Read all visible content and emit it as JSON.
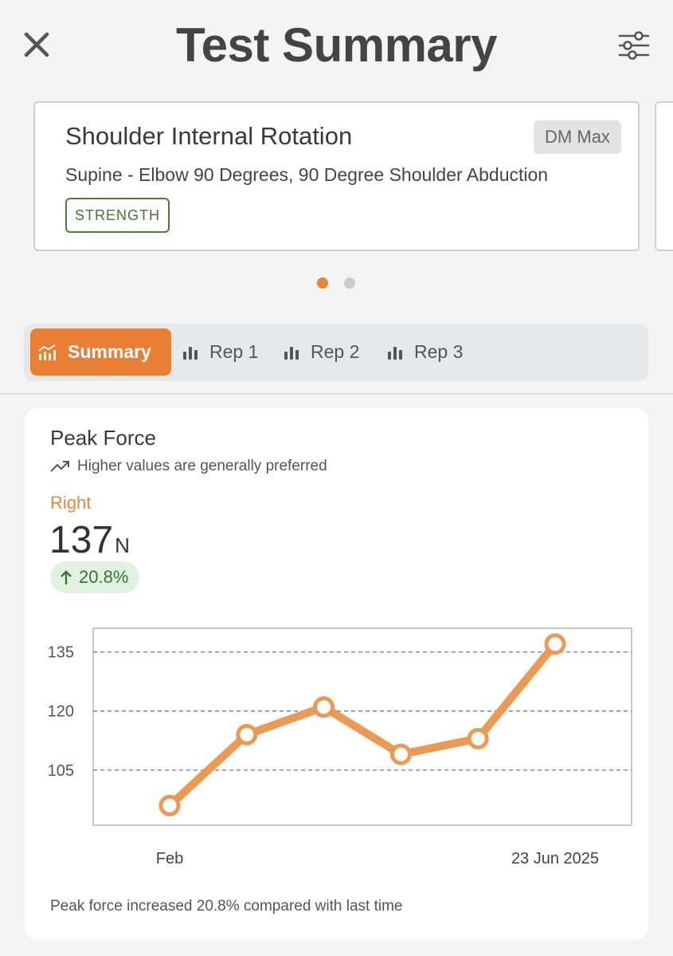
{
  "header": {
    "title": "Test Summary",
    "close_icon": "close-icon",
    "filter_icon": "sliders-icon"
  },
  "test_card": {
    "title": "Shoulder Internal Rotation",
    "subtitle": "Supine - Elbow 90 Degrees, 90 Degree Shoulder Abduction",
    "device_badge": "DM Max",
    "category_tag": "STRENGTH",
    "pager": {
      "total": 2,
      "active": 1
    }
  },
  "tabs": [
    {
      "label": "Summary",
      "icon": "chart-icon",
      "active": true
    },
    {
      "label": "Rep 1",
      "icon": "bar-chart-icon",
      "active": false
    },
    {
      "label": "Rep 2",
      "icon": "bar-chart-icon",
      "active": false
    },
    {
      "label": "Rep 3",
      "icon": "bar-chart-icon",
      "active": false
    }
  ],
  "metric": {
    "title": "Peak Force",
    "hint": "Higher values are generally preferred",
    "side": "Right",
    "value": "137",
    "unit": "N",
    "change": "20.8%",
    "footer": "Peak force increased 20.8% compared with last time"
  },
  "colors": {
    "accent": "#e97f35",
    "line": "#ec9a52",
    "positive": "#2f7a2b",
    "positive_bg": "#e3f1e2",
    "tag_green": "#3d7a24"
  },
  "chart_data": {
    "type": "line",
    "x_labels": [
      "Feb",
      "23 Jun 2025"
    ],
    "y_ticks": [
      105,
      120,
      135
    ],
    "ylim": [
      91,
      141
    ],
    "grid": true,
    "series": [
      {
        "values": [
          96,
          114,
          121,
          109,
          113,
          137
        ]
      }
    ]
  }
}
